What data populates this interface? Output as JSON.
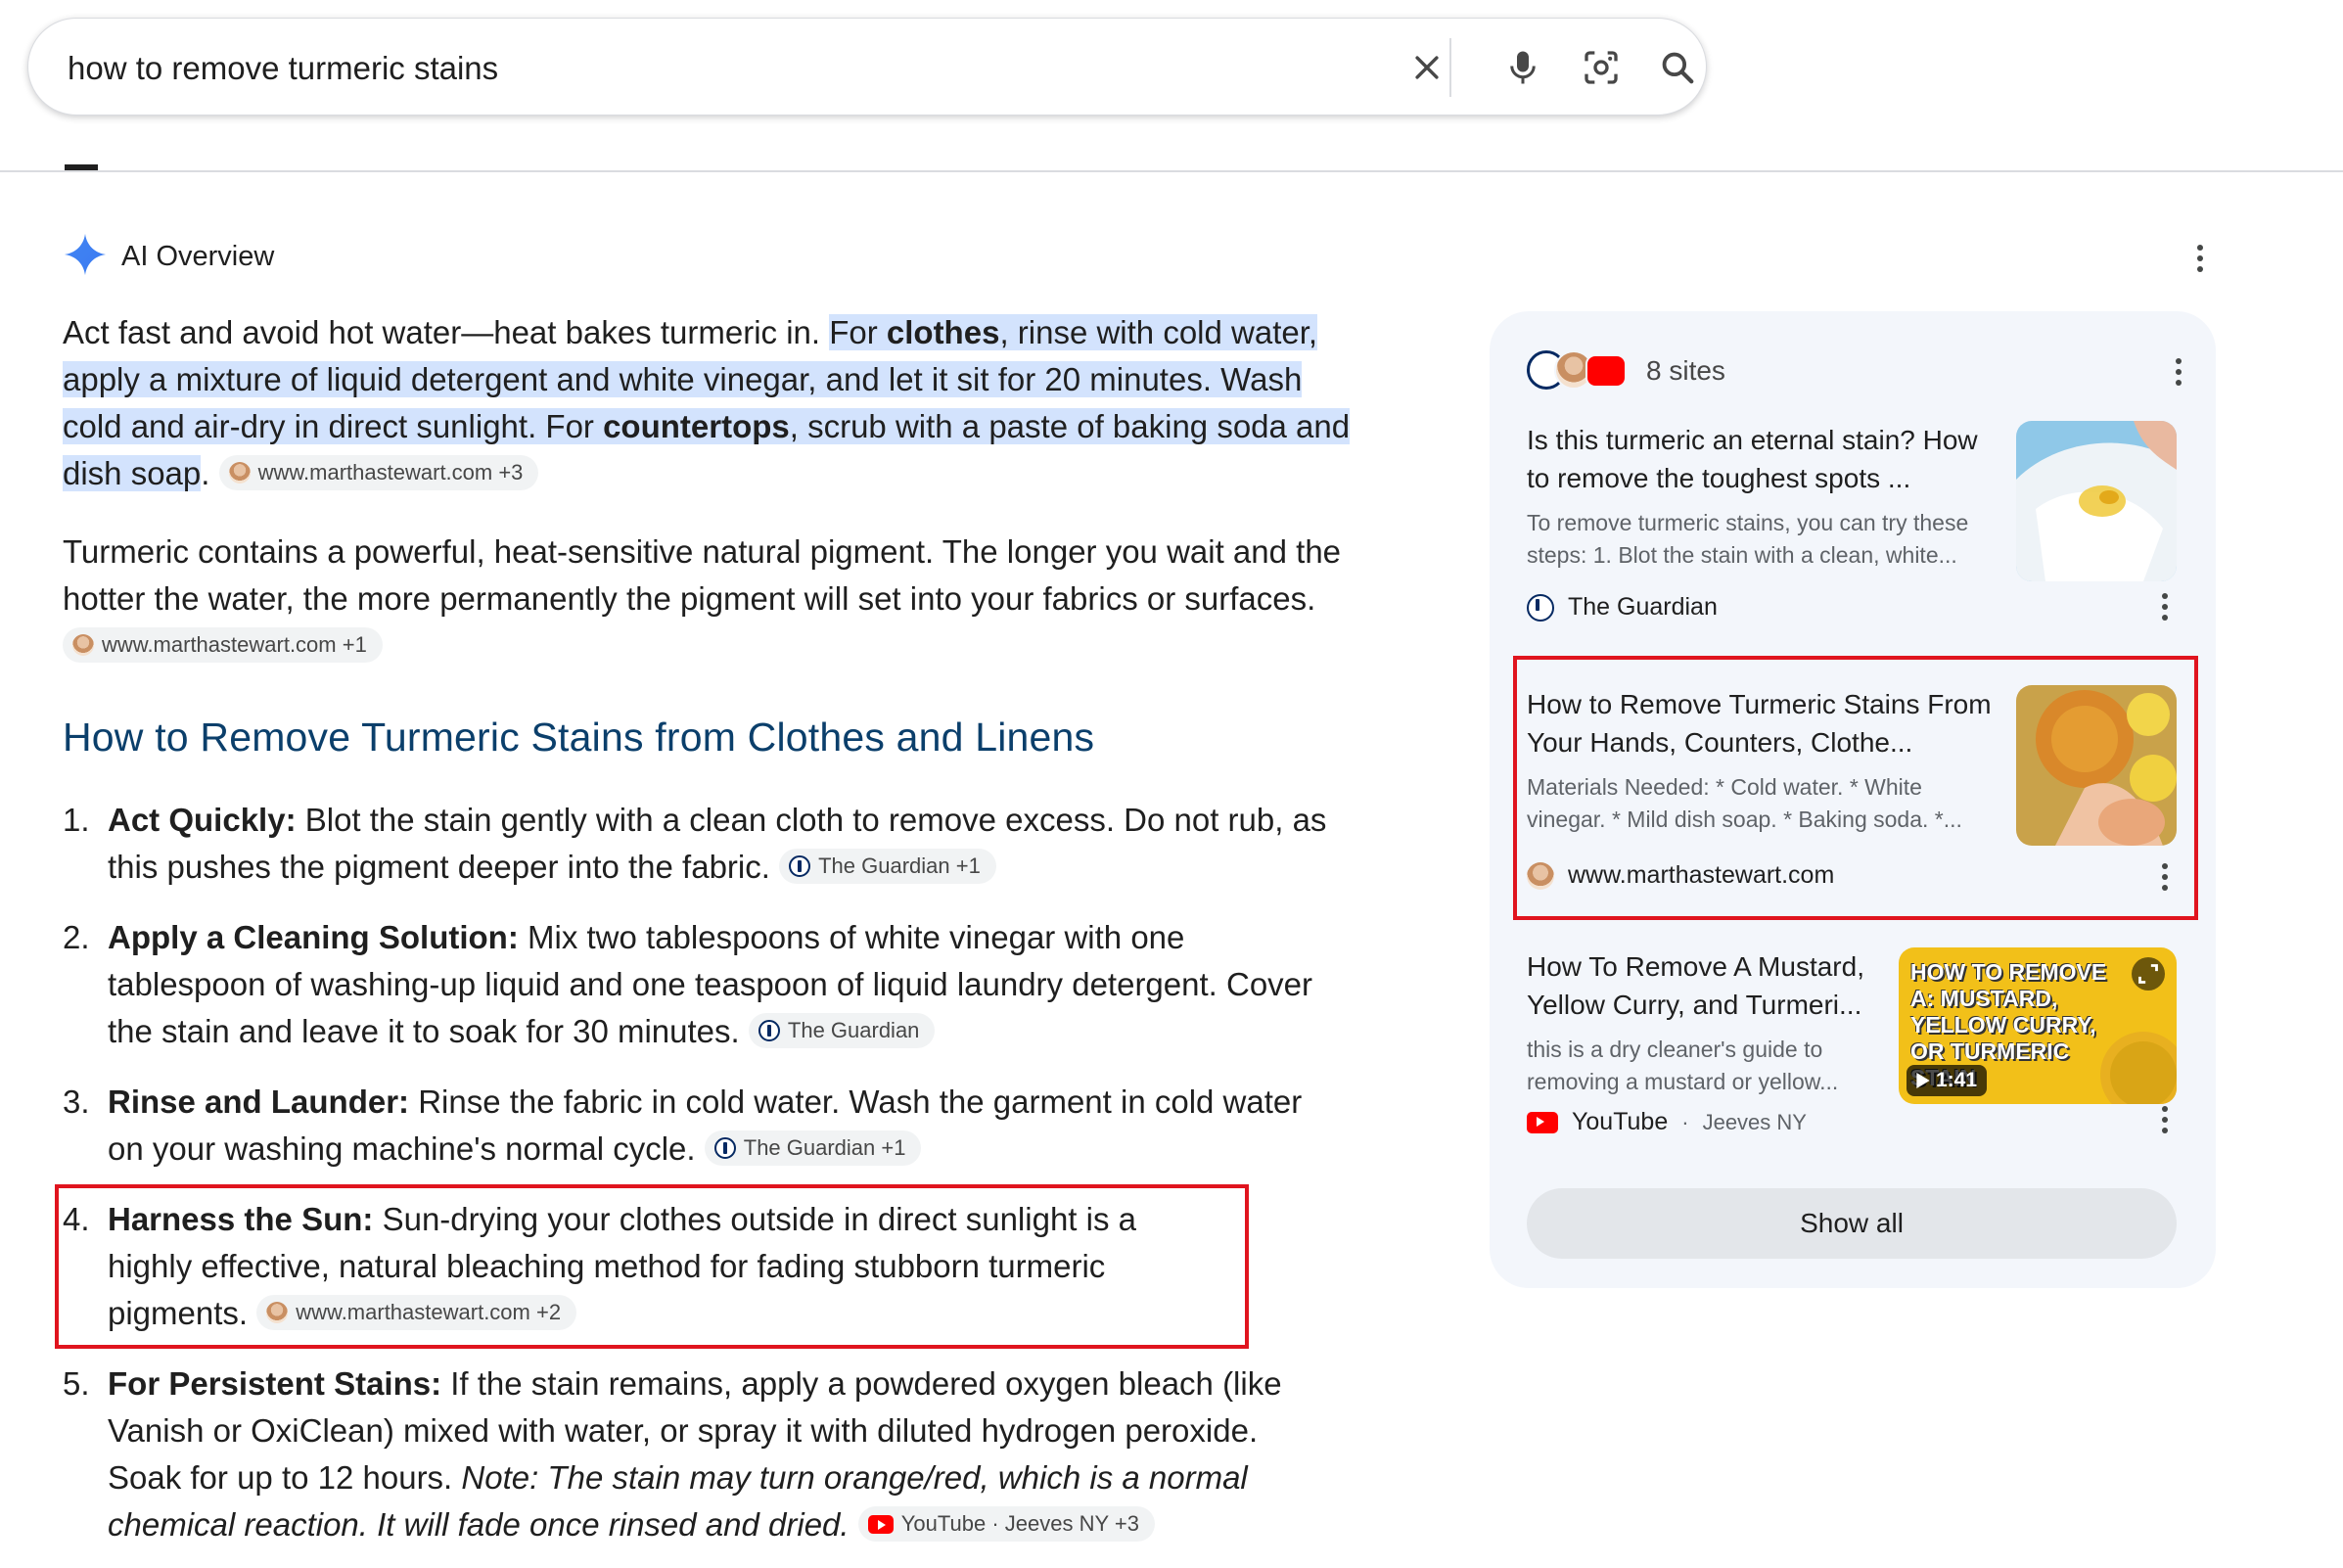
{
  "search": {
    "query": "how to remove turmeric stains"
  },
  "ai_overview": {
    "title": "AI Overview",
    "paragraph1": {
      "plain_intro": "Act fast and avoid hot water—heat bakes turmeric in. ",
      "hl_a": "For ",
      "hl_clothes": "clothes",
      "hl_b": ", rinse with cold water, apply a mixture of liquid detergent and white vinegar, and let it sit for 20 minutes. Wash cold and air-dry in direct sunlight. For ",
      "hl_countertops": "countertops",
      "hl_c": ", scrub with a paste of baking soda and dish soap",
      "end": ".",
      "chip": "www.marthastewart.com +3"
    },
    "paragraph2": {
      "text": "Turmeric contains a powerful, heat-sensitive natural pigment. The longer you wait and the hotter the water, the more permanently the pigment will set into your fabrics or surfaces.",
      "chip": "www.marthastewart.com +1"
    },
    "section_title": "How to Remove Turmeric Stains from Clothes and Linens",
    "steps": [
      {
        "num": "1.",
        "title": "Act Quickly:",
        "text": " Blot the stain gently with a clean cloth to remove excess. Do not rub, as this pushes the pigment deeper into the fabric.",
        "chip": "The Guardian +1"
      },
      {
        "num": "2.",
        "title": "Apply a Cleaning Solution:",
        "text": " Mix two tablespoons of white vinegar with one tablespoon of washing-up liquid and one teaspoon of liquid laundry detergent. Cover the stain and leave it to soak for 30 minutes.",
        "chip": "The Guardian"
      },
      {
        "num": "3.",
        "title": "Rinse and Launder:",
        "text": " Rinse the fabric in cold water. Wash the garment in cold water on your washing machine's normal cycle.",
        "chip": "The Guardian +1"
      },
      {
        "num": "4.",
        "title": "Harness the Sun:",
        "text": " Sun-drying your clothes outside in direct sunlight is a highly effective, natural bleaching method for fading stubborn turmeric pigments.",
        "chip": "www.marthastewart.com +2"
      },
      {
        "num": "5.",
        "title": "For Persistent Stains:",
        "text": " If the stain remains, apply a powdered oxygen bleach (like Vanish or OxiClean) mixed with water, or spray it with diluted hydrogen peroxide. Soak for up to 12 hours. ",
        "note": "Note: The stain may turn orange/red, which is a normal chemical reaction. It will fade once rinsed and dried.",
        "chip": "YouTube · Jeeves NY +3"
      }
    ]
  },
  "sources_panel": {
    "sites_count": "8 sites",
    "cards": [
      {
        "title": "Is this turmeric an eternal stain? How to remove the toughest spots ...",
        "snippet": "To remove turmeric stains, you can try these steps: 1. Blot the stain with a clean, white...",
        "source": "The Guardian"
      },
      {
        "title": "How to Remove Turmeric Stains From Your Hands, Counters, Clothe...",
        "snippet": "Materials Needed: * Cold water. * White vinegar. * Mild dish soap. * Baking soda. *...",
        "source": "www.marthastewart.com"
      },
      {
        "title": "How To Remove A Mustard, Yellow Curry, and Turmeri...",
        "snippet": "this is a dry cleaner's guide to removing a mustard or yellow...",
        "source": "YouTube",
        "source_sub": "Jeeves NY",
        "video_duration": "1:41",
        "thumb_text": "HOW TO REMOVE A: MUSTARD, YELLOW CURRY, OR TURMERIC STAIN"
      }
    ],
    "show_all": "Show all"
  },
  "colors": {
    "highlight": "#d3e3fd",
    "section_title": "#0b3f6b",
    "annotation_red": "#e0141e",
    "panel_bg": "#f3f6fb"
  },
  "icons": [
    "clear-icon",
    "mic-icon",
    "lens-icon",
    "search-icon",
    "ai-sparkle-icon",
    "more-vert-icon"
  ]
}
